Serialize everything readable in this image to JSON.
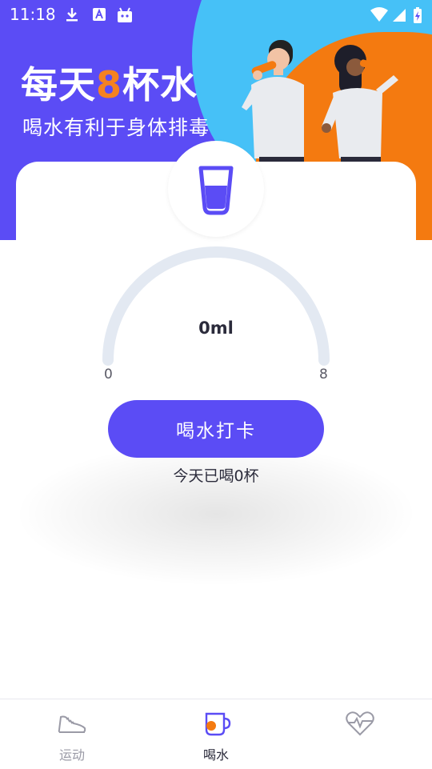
{
  "status_bar": {
    "time": "11:18"
  },
  "hero": {
    "title_before": "每天",
    "title_accent": "8",
    "title_after": "杯水",
    "subtitle": "喝水有利于身体排毒"
  },
  "gauge": {
    "current_text": "0ml",
    "min_label": "0",
    "max_label": "8",
    "progress": 0
  },
  "checkin_button": {
    "label": "喝水打卡"
  },
  "today_text": "今天已喝0杯",
  "bottom_nav": {
    "items": [
      {
        "label": "运动",
        "icon": "sneaker-icon",
        "active": false
      },
      {
        "label": "喝水",
        "icon": "mug-icon",
        "active": true
      },
      {
        "label": "",
        "icon": "heart-pulse-icon",
        "active": false
      }
    ]
  },
  "colors": {
    "primary": "#5b4cf5",
    "accent_orange": "#f47a10",
    "accent_blue": "#46c1f7",
    "gauge_track": "#e3e9f2"
  }
}
